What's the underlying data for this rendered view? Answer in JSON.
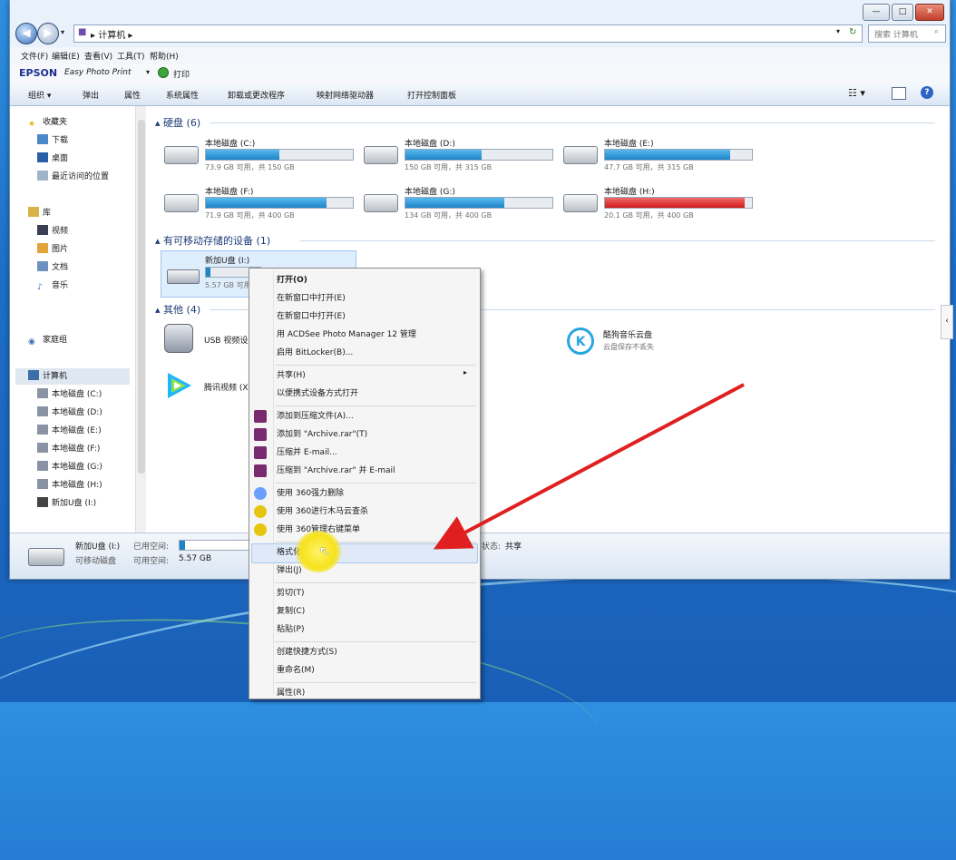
{
  "window": {
    "controls": {
      "minimize": "—",
      "maximize": "□",
      "close": "✕"
    }
  },
  "address": {
    "path": "▸ 计算机 ▸",
    "search_placeholder": "搜索 计算机"
  },
  "menubar": [
    "文件(F)",
    "编辑(E)",
    "查看(V)",
    "工具(T)",
    "帮助(H)"
  ],
  "epson": {
    "brand": "EPSON",
    "app": "Easy Photo Print",
    "print": "打印"
  },
  "toolbar": [
    "组织 ▾",
    "弹出",
    "属性",
    "系统属性",
    "卸载或更改程序",
    "映射网络驱动器",
    "打开控制面板"
  ],
  "nav": {
    "favorites": {
      "title": "收藏夹",
      "items": [
        "下载",
        "桌面",
        "最近访问的位置"
      ]
    },
    "libraries": {
      "title": "库",
      "items": [
        "视频",
        "图片",
        "文档",
        "音乐"
      ]
    },
    "homegroup": "家庭组",
    "computer": {
      "title": "计算机",
      "items": [
        "本地磁盘 (C:)",
        "本地磁盘 (D:)",
        "本地磁盘 (E:)",
        "本地磁盘 (F:)",
        "本地磁盘 (G:)",
        "本地磁盘 (H:)",
        "新加U盘 (I:)"
      ]
    }
  },
  "groups": {
    "hdd": "硬盘 (6)",
    "removable": "有可移动存储的设备 (1)",
    "other": "其他 (4)"
  },
  "drives": [
    {
      "name": "本地磁盘 (C:)",
      "free": "73.9 GB 可用，共 150 GB",
      "used": 0.5,
      "color": "#1d84c8"
    },
    {
      "name": "本地磁盘 (D:)",
      "free": "150 GB 可用，共 315 GB",
      "used": 0.52,
      "color": "#1d84c8"
    },
    {
      "name": "本地磁盘 (E:)",
      "free": "47.7 GB 可用，共 315 GB",
      "used": 0.85,
      "color": "#1d84c8"
    },
    {
      "name": "本地磁盘 (F:)",
      "free": "71.9 GB 可用，共 400 GB",
      "used": 0.82,
      "color": "#1d84c8"
    },
    {
      "name": "本地磁盘 (G:)",
      "free": "134 GB 可用，共 400 GB",
      "used": 0.67,
      "color": "#1d84c8"
    },
    {
      "name": "本地磁盘 (H:)",
      "free": "20.1 GB 可用，共 400 GB",
      "used": 0.95,
      "color": "#d01818"
    }
  ],
  "usb": {
    "name": "新加U盘 (I:)",
    "free": "5.57 GB 可用",
    "used": 0.08
  },
  "other_items": [
    {
      "name": "USB 视频设备"
    },
    {
      "name": "腾讯视频 (X)"
    },
    {
      "name": "酷狗音乐云盘",
      "sub": "云盘保存不丢失"
    }
  ],
  "status": {
    "name": "新加U盘 (I:)",
    "used_label": "已用空间:",
    "type": "可移动磁盘",
    "avail_label": "可用空间:",
    "avail_value": "5.57 GB",
    "state_label": "状态:",
    "state_value": "共享"
  },
  "context_menu": [
    {
      "label": "打开(O)",
      "bold": true
    },
    {
      "label": "在新窗口中打开(E)"
    },
    {
      "label": "在新窗口中打开(E)"
    },
    {
      "label": "用 ACDSee Photo Manager 12 管理"
    },
    {
      "label": "启用 BitLocker(B)..."
    },
    {
      "sep": true
    },
    {
      "label": "共享(H)",
      "sub": true
    },
    {
      "label": "以便携式设备方式打开"
    },
    {
      "sep": true
    },
    {
      "label": "添加到压缩文件(A)...",
      "icon": "rar"
    },
    {
      "label": "添加到 \"Archive.rar\"(T)",
      "icon": "rar"
    },
    {
      "label": "压缩并 E-mail...",
      "icon": "rar"
    },
    {
      "label": "压缩到 \"Archive.rar\" 并 E-mail",
      "icon": "rar"
    },
    {
      "sep": true
    },
    {
      "label": "使用 360强力删除",
      "icon": "360b"
    },
    {
      "label": "使用 360进行木马云查杀",
      "icon": "360y"
    },
    {
      "label": "使用 360管理右键菜单",
      "icon": "360y"
    },
    {
      "sep": true
    },
    {
      "label": "格式化(A)...",
      "highlight": true
    },
    {
      "label": "弹出(J)"
    },
    {
      "sep": true
    },
    {
      "label": "剪切(T)"
    },
    {
      "label": "复制(C)"
    },
    {
      "label": "粘贴(P)"
    },
    {
      "sep": true
    },
    {
      "label": "创建快捷方式(S)"
    },
    {
      "label": "重命名(M)"
    },
    {
      "sep": true
    },
    {
      "label": "属性(R)"
    }
  ],
  "colors": {
    "accent": "#1d84c8",
    "danger": "#d01818",
    "arrow": "#e02020",
    "highlight": "#f6e21a"
  }
}
